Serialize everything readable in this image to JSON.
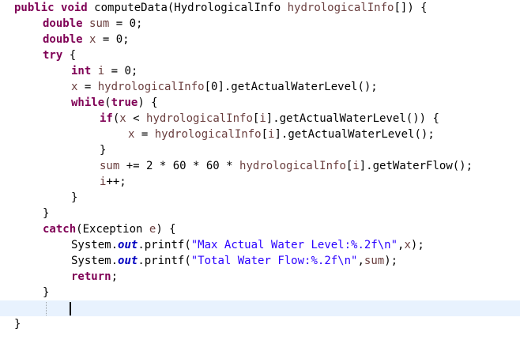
{
  "editor": {
    "title": "",
    "lines": [
      {
        "indent": 0,
        "tokens": [
          {
            "t": "public",
            "c": "kw"
          },
          {
            "t": " "
          },
          {
            "t": "void",
            "c": "kw"
          },
          {
            "t": " computeData(HydrologicalInfo "
          },
          {
            "t": "hydrologicalInfo",
            "c": "var"
          },
          {
            "t": "[]) {"
          }
        ]
      },
      {
        "indent": 1,
        "tokens": [
          {
            "t": "double",
            "c": "kw"
          },
          {
            "t": " "
          },
          {
            "t": "sum",
            "c": "var"
          },
          {
            "t": " = 0;"
          }
        ]
      },
      {
        "indent": 1,
        "tokens": [
          {
            "t": "double",
            "c": "kw"
          },
          {
            "t": " "
          },
          {
            "t": "x",
            "c": "var"
          },
          {
            "t": " = 0;"
          }
        ]
      },
      {
        "indent": 1,
        "tokens": [
          {
            "t": "try",
            "c": "kw"
          },
          {
            "t": " {"
          }
        ]
      },
      {
        "indent": 2,
        "tokens": [
          {
            "t": "int",
            "c": "kw"
          },
          {
            "t": " "
          },
          {
            "t": "i",
            "c": "var"
          },
          {
            "t": " = 0;"
          }
        ]
      },
      {
        "indent": 2,
        "tokens": [
          {
            "t": "x",
            "c": "var"
          },
          {
            "t": " = "
          },
          {
            "t": "hydrologicalInfo",
            "c": "var"
          },
          {
            "t": "[0].getActualWaterLevel();"
          }
        ]
      },
      {
        "indent": 2,
        "tokens": [
          {
            "t": "while",
            "c": "kw"
          },
          {
            "t": "("
          },
          {
            "t": "true",
            "c": "kw"
          },
          {
            "t": ") {"
          }
        ]
      },
      {
        "indent": 3,
        "tokens": [
          {
            "t": "if",
            "c": "kw"
          },
          {
            "t": "("
          },
          {
            "t": "x",
            "c": "var"
          },
          {
            "t": " < "
          },
          {
            "t": "hydrologicalInfo",
            "c": "var"
          },
          {
            "t": "["
          },
          {
            "t": "i",
            "c": "var"
          },
          {
            "t": "].getActualWaterLevel()) {"
          }
        ]
      },
      {
        "indent": 4,
        "tokens": [
          {
            "t": "x",
            "c": "var"
          },
          {
            "t": " = "
          },
          {
            "t": "hydrologicalInfo",
            "c": "var"
          },
          {
            "t": "["
          },
          {
            "t": "i",
            "c": "var"
          },
          {
            "t": "].getActualWaterLevel();"
          }
        ]
      },
      {
        "indent": 3,
        "tokens": [
          {
            "t": "}"
          }
        ]
      },
      {
        "indent": 3,
        "tokens": [
          {
            "t": "sum",
            "c": "var"
          },
          {
            "t": " += 2 * 60 * 60 * "
          },
          {
            "t": "hydrologicalInfo",
            "c": "var"
          },
          {
            "t": "["
          },
          {
            "t": "i",
            "c": "var"
          },
          {
            "t": "].getWaterFlow();"
          }
        ]
      },
      {
        "indent": 3,
        "tokens": [
          {
            "t": "i",
            "c": "var"
          },
          {
            "t": "++;"
          }
        ]
      },
      {
        "indent": 2,
        "tokens": [
          {
            "t": "}"
          }
        ]
      },
      {
        "indent": 1,
        "tokens": [
          {
            "t": "}"
          }
        ]
      },
      {
        "indent": 1,
        "tokens": [
          {
            "t": "catch",
            "c": "kw"
          },
          {
            "t": "(Exception "
          },
          {
            "t": "e",
            "c": "var"
          },
          {
            "t": ") {"
          }
        ]
      },
      {
        "indent": 2,
        "tokens": [
          {
            "t": "System."
          },
          {
            "t": "out",
            "c": "fld"
          },
          {
            "t": ".printf("
          },
          {
            "t": "\"Max Actual Water Level:%.2f\\n\"",
            "c": "str"
          },
          {
            "t": ","
          },
          {
            "t": "x",
            "c": "var"
          },
          {
            "t": ");"
          }
        ]
      },
      {
        "indent": 2,
        "tokens": [
          {
            "t": "System."
          },
          {
            "t": "out",
            "c": "fld"
          },
          {
            "t": ".printf("
          },
          {
            "t": "\"Total Water Flow:%.2f\\n\"",
            "c": "str"
          },
          {
            "t": ","
          },
          {
            "t": "sum",
            "c": "var"
          },
          {
            "t": ");"
          }
        ]
      },
      {
        "indent": 2,
        "tokens": [
          {
            "t": "return",
            "c": "kw"
          },
          {
            "t": ";"
          }
        ]
      },
      {
        "indent": 1,
        "tokens": [
          {
            "t": "}"
          }
        ]
      },
      {
        "indent": 1,
        "tokens": [],
        "current": true
      },
      {
        "indent": 0,
        "tokens": [
          {
            "t": "}"
          }
        ]
      }
    ]
  },
  "colors": {
    "keyword": "#7f0055",
    "variable": "#6a3e3e",
    "string": "#2a00ff",
    "static_field": "#0000c0",
    "current_line": "#e8f2fe"
  }
}
